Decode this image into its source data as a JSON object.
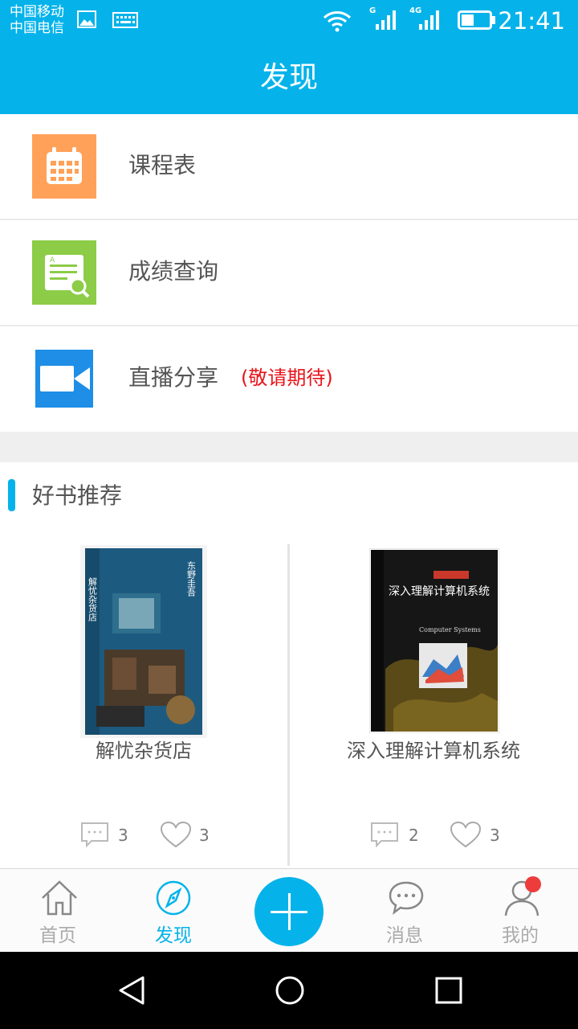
{
  "status_bar": {
    "carrier_1": "中国移动",
    "carrier_2": "中国电信",
    "net_label_1": "G",
    "net_label_2": "4G",
    "time": "21:41",
    "icons": [
      "image-icon",
      "keyboard-icon",
      "wifi-icon",
      "signal-icon",
      "battery-icon"
    ],
    "battery_level": 0.45
  },
  "header": {
    "title": "发现"
  },
  "menu": [
    {
      "label": "课程表",
      "icon": "calendar-icon",
      "icon_color": "#ffa158"
    },
    {
      "label": "成绩查询",
      "icon": "grade-search-icon",
      "icon_color": "#8ccc47"
    },
    {
      "label": "直播分享",
      "icon": "video-camera-icon",
      "icon_color": "#1e8ee6",
      "note": "(敬请期待)",
      "note_color": "#e8141b"
    }
  ],
  "books_section": {
    "title": "好书推荐",
    "books": [
      {
        "name": "解忧杂货店",
        "comments": "3",
        "likes": "3",
        "cover_title": "解忧杂货店",
        "cover_subtitle": "东野圭吾"
      },
      {
        "name": "深入理解计算机系统",
        "comments": "2",
        "likes": "3",
        "cover_title": "深入理解计算机系统",
        "cover_subtitle": "Computer Systems"
      }
    ]
  },
  "tabbar": {
    "tabs": [
      {
        "label": "首页",
        "icon": "home-icon"
      },
      {
        "label": "发现",
        "icon": "compass-icon",
        "active": true
      },
      {
        "label": "消息",
        "icon": "chat-icon"
      },
      {
        "label": "我的",
        "icon": "user-icon"
      }
    ],
    "center_button_icon": "plus-icon",
    "accent_color": "#05b3ea"
  },
  "system_nav": [
    "back-icon",
    "home-circle-icon",
    "recents-icon"
  ]
}
